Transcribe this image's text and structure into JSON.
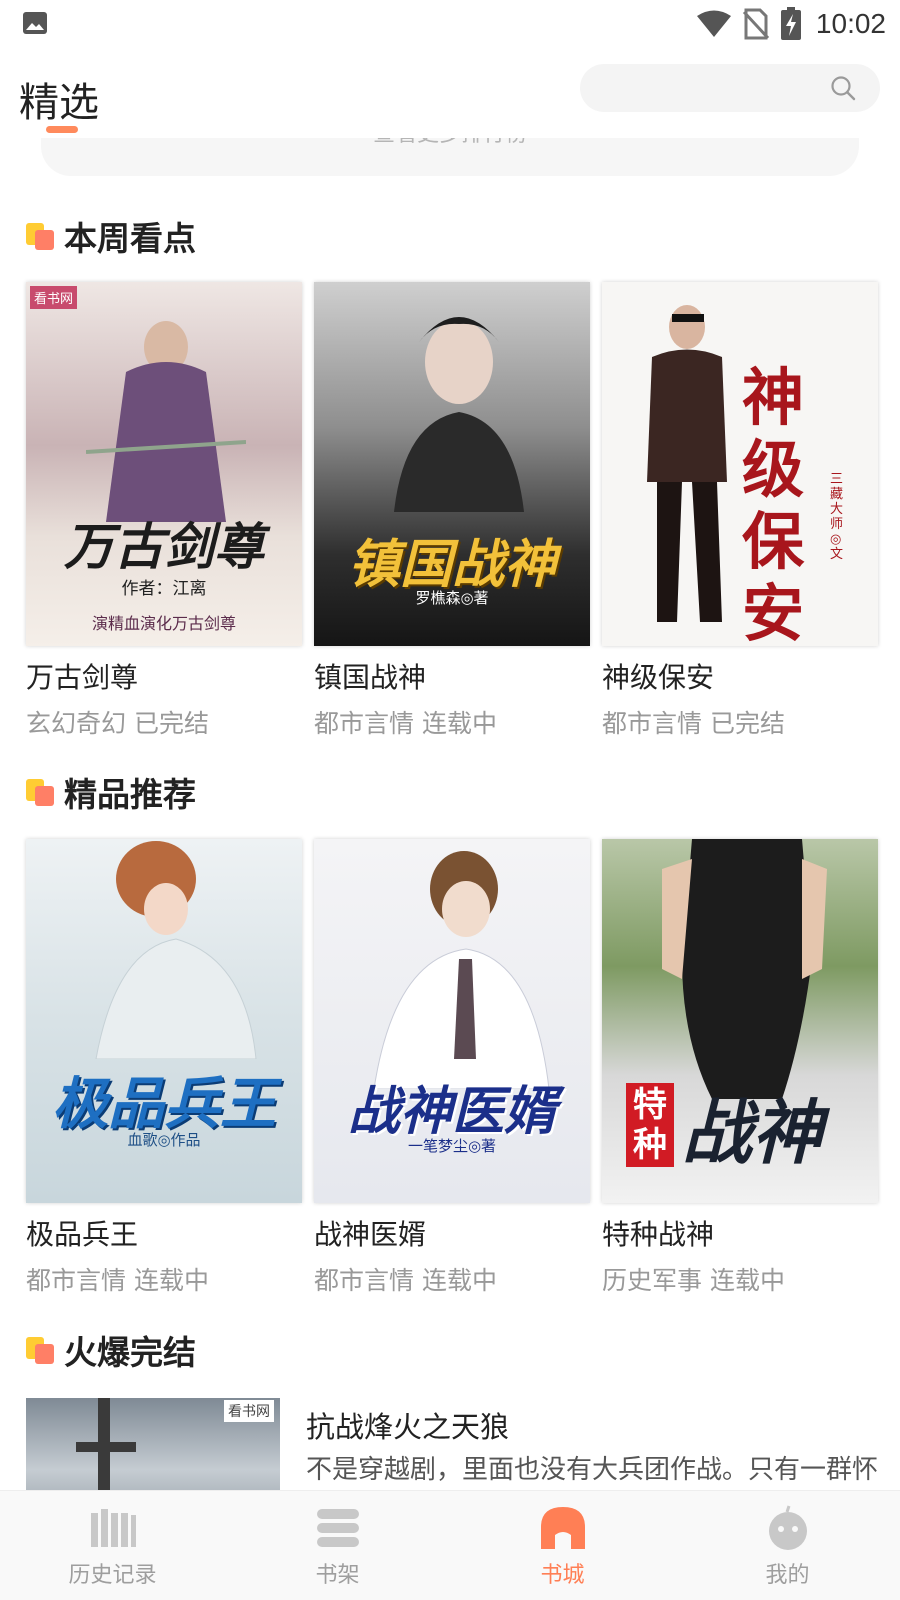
{
  "status_bar": {
    "time": "10:02"
  },
  "header": {
    "active_tab": "精选",
    "search_placeholder": ""
  },
  "more_rankings_text": "查看更多排行榜",
  "sections": [
    {
      "title": "本周看点",
      "books": [
        {
          "name": "万古剑尊",
          "genre": "玄幻奇幻",
          "status": "已完结",
          "cover_title": "万古剑尊",
          "cover_author": "作者：江离",
          "cover_tagline": "演精血演化万古剑尊",
          "cover_brand": "看书网"
        },
        {
          "name": "镇国战神",
          "genre": "都市言情",
          "status": "连载中",
          "cover_title": "镇国战神",
          "cover_author": "罗樵森◎著"
        },
        {
          "name": "神级保安",
          "genre": "都市言情",
          "status": "已完结",
          "cover_title": "神级保安",
          "cover_author": "三藏大师◎文"
        }
      ]
    },
    {
      "title": "精品推荐",
      "books": [
        {
          "name": "极品兵王",
          "genre": "都市言情",
          "status": "连载中",
          "cover_title": "极品兵王",
          "cover_author": "血歌◎作品"
        },
        {
          "name": "战神医婿",
          "genre": "都市言情",
          "status": "连载中",
          "cover_title": "战神医婿",
          "cover_author": "一笔梦尘◎著"
        },
        {
          "name": "特种战神",
          "genre": "历史军事",
          "status": "连载中",
          "cover_title": "战神",
          "cover_badge": "特种"
        }
      ]
    },
    {
      "title": "火爆完结",
      "list": [
        {
          "name": "抗战烽火之天狼",
          "desc": "不是穿越剧，里面也没有大兵团作战。只有一群怀着拳拳爱国之心的青年，用他们的智慧，完成一个接",
          "cover_brand": "看书网"
        }
      ]
    }
  ],
  "bottom_nav": [
    {
      "label": "历史记录",
      "icon": "history-icon",
      "active": false
    },
    {
      "label": "书架",
      "icon": "bookshelf-icon",
      "active": false
    },
    {
      "label": "书城",
      "icon": "bookstore-icon",
      "active": true
    },
    {
      "label": "我的",
      "icon": "profile-icon",
      "active": false
    }
  ],
  "colors": {
    "accent": "#ff7f55",
    "section_icon_yellow": "#ffcc33",
    "section_icon_red": "#ff7f66",
    "muted_text": "#999999"
  }
}
